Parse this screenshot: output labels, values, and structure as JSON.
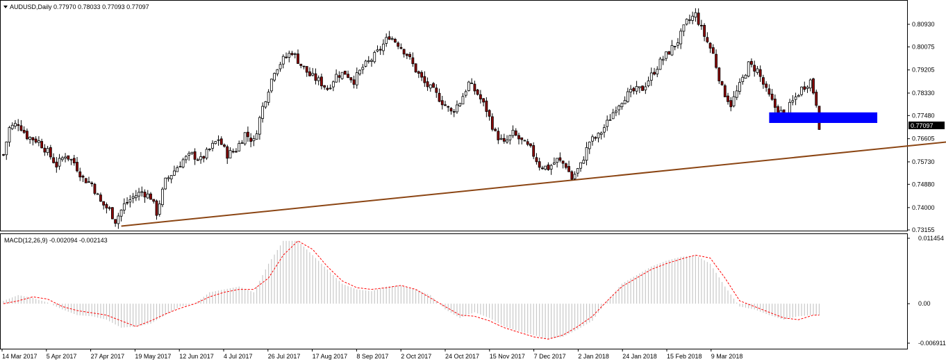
{
  "header": {
    "symbol_label": "AUDUSD,Daily",
    "ohlc": "0.77970 0.78033 0.77093 0.77097"
  },
  "macd_header": {
    "label": "MACD(12,26,9) -0.002094 -0.002143"
  },
  "colors": {
    "up_candle": "#000000",
    "down_candle": "#000000",
    "down_body_accent": "#8b0000",
    "trendline": "#8b4513",
    "zone": "#0000ff",
    "histogram": "#c8c8c8",
    "signal": "#ff0000",
    "grid_border": "#000000"
  },
  "chart_data": [
    {
      "type": "candlestick",
      "ylim": [
        0.73155,
        0.815
      ],
      "y_ticks": [
        "0.80930",
        "0.80075",
        "0.79205",
        "0.78330",
        "0.77480",
        "0.76605",
        "0.75730",
        "0.74880",
        "0.74000",
        "0.73155"
      ],
      "x_ticks": [
        "14 Mar 2017",
        "5 Apr 2017",
        "27 Apr 2017",
        "19 May 2017",
        "12 Jun 2017",
        "4 Jul 2017",
        "26 Jul 2017",
        "17 Aug 2017",
        "8 Sep 2017",
        "2 Oct 2017",
        "24 Oct 2017",
        "15 Nov 2017",
        "7 Dec 2017",
        "2 Jan 2018",
        "24 Jan 2018",
        "15 Feb 2018",
        "9 Mar 2018"
      ],
      "current_price": "0.77097",
      "close_path": [
        [
          0,
          0.76
        ],
        [
          2,
          0.77
        ],
        [
          5,
          0.772
        ],
        [
          8,
          0.767
        ],
        [
          12,
          0.765
        ],
        [
          15,
          0.761
        ],
        [
          18,
          0.756
        ],
        [
          21,
          0.76
        ],
        [
          24,
          0.757
        ],
        [
          27,
          0.751
        ],
        [
          30,
          0.749
        ],
        [
          33,
          0.742
        ],
        [
          36,
          0.739
        ],
        [
          38,
          0.735
        ],
        [
          41,
          0.741
        ],
        [
          44,
          0.744
        ],
        [
          47,
          0.746
        ],
        [
          50,
          0.744
        ],
        [
          52,
          0.738
        ],
        [
          55,
          0.75
        ],
        [
          58,
          0.754
        ],
        [
          61,
          0.758
        ],
        [
          64,
          0.76
        ],
        [
          67,
          0.758
        ],
        [
          70,
          0.762
        ],
        [
          73,
          0.766
        ],
        [
          76,
          0.76
        ],
        [
          79,
          0.762
        ],
        [
          82,
          0.768
        ],
        [
          85,
          0.765
        ],
        [
          88,
          0.778
        ],
        [
          90,
          0.785
        ],
        [
          92,
          0.792
        ],
        [
          95,
          0.796
        ],
        [
          98,
          0.799
        ],
        [
          101,
          0.794
        ],
        [
          104,
          0.79
        ],
        [
          107,
          0.788
        ],
        [
          110,
          0.785
        ],
        [
          113,
          0.79
        ],
        [
          116,
          0.791
        ],
        [
          119,
          0.788
        ],
        [
          122,
          0.793
        ],
        [
          125,
          0.796
        ],
        [
          128,
          0.8
        ],
        [
          131,
          0.805
        ],
        [
          134,
          0.802
        ],
        [
          137,
          0.798
        ],
        [
          140,
          0.792
        ],
        [
          143,
          0.787
        ],
        [
          146,
          0.784
        ],
        [
          149,
          0.78
        ],
        [
          152,
          0.776
        ],
        [
          155,
          0.78
        ],
        [
          158,
          0.787
        ],
        [
          161,
          0.783
        ],
        [
          164,
          0.777
        ],
        [
          167,
          0.768
        ],
        [
          170,
          0.764
        ],
        [
          173,
          0.768
        ],
        [
          176,
          0.765
        ],
        [
          179,
          0.762
        ],
        [
          182,
          0.756
        ],
        [
          185,
          0.755
        ],
        [
          188,
          0.758
        ],
        [
          191,
          0.756
        ],
        [
          193,
          0.751
        ],
        [
          196,
          0.756
        ],
        [
          199,
          0.765
        ],
        [
          202,
          0.767
        ],
        [
          205,
          0.772
        ],
        [
          208,
          0.778
        ],
        [
          211,
          0.782
        ],
        [
          214,
          0.784
        ],
        [
          217,
          0.785
        ],
        [
          220,
          0.79
        ],
        [
          223,
          0.795
        ],
        [
          226,
          0.799
        ],
        [
          229,
          0.803
        ],
        [
          232,
          0.81
        ],
        [
          235,
          0.813
        ],
        [
          238,
          0.805
        ],
        [
          241,
          0.798
        ],
        [
          244,
          0.785
        ],
        [
          247,
          0.779
        ],
        [
          250,
          0.786
        ],
        [
          253,
          0.794
        ],
        [
          256,
          0.792
        ],
        [
          259,
          0.784
        ],
        [
          262,
          0.778
        ],
        [
          265,
          0.775
        ],
        [
          268,
          0.78
        ],
        [
          271,
          0.785
        ],
        [
          274,
          0.788
        ],
        [
          276,
          0.7797
        ],
        [
          277,
          0.771
        ]
      ],
      "annotations": {
        "trendline": {
          "from": [
            40,
            0.733
          ],
          "to": [
            322,
            0.765
          ]
        },
        "zone": {
          "from_bar": 260,
          "to_bar": 296,
          "price_high": 0.776,
          "price_low": 0.772
        }
      }
    },
    {
      "type": "bar",
      "name": "MACD(12,26,9)",
      "ylim": [
        -0.006911,
        0.011454
      ],
      "y_ticks": [
        "0.011454",
        "0.00",
        "-0.006911"
      ],
      "histogram_path": [
        [
          0,
          0.0005
        ],
        [
          5,
          0.0015
        ],
        [
          10,
          0.001
        ],
        [
          15,
          0.0002
        ],
        [
          20,
          -0.001
        ],
        [
          25,
          -0.002
        ],
        [
          30,
          -0.0022
        ],
        [
          35,
          -0.0028
        ],
        [
          40,
          -0.0042
        ],
        [
          45,
          -0.004
        ],
        [
          50,
          -0.0035
        ],
        [
          55,
          -0.002
        ],
        [
          60,
          -0.0005
        ],
        [
          65,
          0.0
        ],
        [
          70,
          0.002
        ],
        [
          75,
          0.0025
        ],
        [
          80,
          0.003
        ],
        [
          85,
          0.002
        ],
        [
          90,
          0.007
        ],
        [
          95,
          0.011
        ],
        [
          100,
          0.011
        ],
        [
          105,
          0.0085
        ],
        [
          110,
          0.006
        ],
        [
          115,
          0.0035
        ],
        [
          120,
          0.0025
        ],
        [
          125,
          0.0022
        ],
        [
          130,
          0.003
        ],
        [
          135,
          0.0032
        ],
        [
          140,
          0.0025
        ],
        [
          145,
          0.0015
        ],
        [
          150,
          -0.001
        ],
        [
          155,
          -0.0025
        ],
        [
          160,
          -0.0015
        ],
        [
          165,
          -0.0025
        ],
        [
          170,
          -0.004
        ],
        [
          175,
          -0.0048
        ],
        [
          180,
          -0.0055
        ],
        [
          185,
          -0.0062
        ],
        [
          190,
          -0.0058
        ],
        [
          195,
          -0.0045
        ],
        [
          200,
          -0.003
        ],
        [
          205,
          0.0005
        ],
        [
          210,
          0.0035
        ],
        [
          215,
          0.005
        ],
        [
          220,
          0.0065
        ],
        [
          225,
          0.0075
        ],
        [
          230,
          0.0082
        ],
        [
          235,
          0.0085
        ],
        [
          240,
          0.007
        ],
        [
          245,
          0.003
        ],
        [
          250,
          -0.0005
        ],
        [
          255,
          -0.001
        ],
        [
          260,
          -0.002
        ],
        [
          265,
          -0.0028
        ],
        [
          270,
          -0.0022
        ],
        [
          275,
          -0.002
        ]
      ],
      "signal_path": [
        [
          0,
          0.0
        ],
        [
          5,
          0.0005
        ],
        [
          10,
          0.0012
        ],
        [
          15,
          0.0008
        ],
        [
          20,
          -0.0005
        ],
        [
          25,
          -0.0012
        ],
        [
          30,
          -0.0016
        ],
        [
          35,
          -0.002
        ],
        [
          40,
          -0.003
        ],
        [
          45,
          -0.004
        ],
        [
          50,
          -0.003
        ],
        [
          55,
          -0.0018
        ],
        [
          60,
          -0.0008
        ],
        [
          65,
          0.0
        ],
        [
          70,
          0.0012
        ],
        [
          75,
          0.002
        ],
        [
          80,
          0.0025
        ],
        [
          85,
          0.0025
        ],
        [
          90,
          0.0045
        ],
        [
          95,
          0.0085
        ],
        [
          100,
          0.011
        ],
        [
          105,
          0.0095
        ],
        [
          110,
          0.0065
        ],
        [
          115,
          0.004
        ],
        [
          120,
          0.0028
        ],
        [
          125,
          0.0025
        ],
        [
          130,
          0.0028
        ],
        [
          135,
          0.0032
        ],
        [
          140,
          0.0025
        ],
        [
          145,
          0.001
        ],
        [
          150,
          -0.0005
        ],
        [
          155,
          -0.002
        ],
        [
          160,
          -0.0022
        ],
        [
          165,
          -0.003
        ],
        [
          170,
          -0.0042
        ],
        [
          175,
          -0.005
        ],
        [
          180,
          -0.0058
        ],
        [
          185,
          -0.0062
        ],
        [
          190,
          -0.0055
        ],
        [
          195,
          -0.004
        ],
        [
          200,
          -0.0022
        ],
        [
          205,
          0.0005
        ],
        [
          210,
          0.003
        ],
        [
          215,
          0.0045
        ],
        [
          220,
          0.006
        ],
        [
          225,
          0.007
        ],
        [
          230,
          0.0078
        ],
        [
          235,
          0.0085
        ],
        [
          240,
          0.008
        ],
        [
          245,
          0.0045
        ],
        [
          250,
          0.0005
        ],
        [
          255,
          -0.0005
        ],
        [
          260,
          -0.0015
        ],
        [
          265,
          -0.0025
        ],
        [
          270,
          -0.0028
        ],
        [
          275,
          -0.002
        ]
      ]
    }
  ]
}
